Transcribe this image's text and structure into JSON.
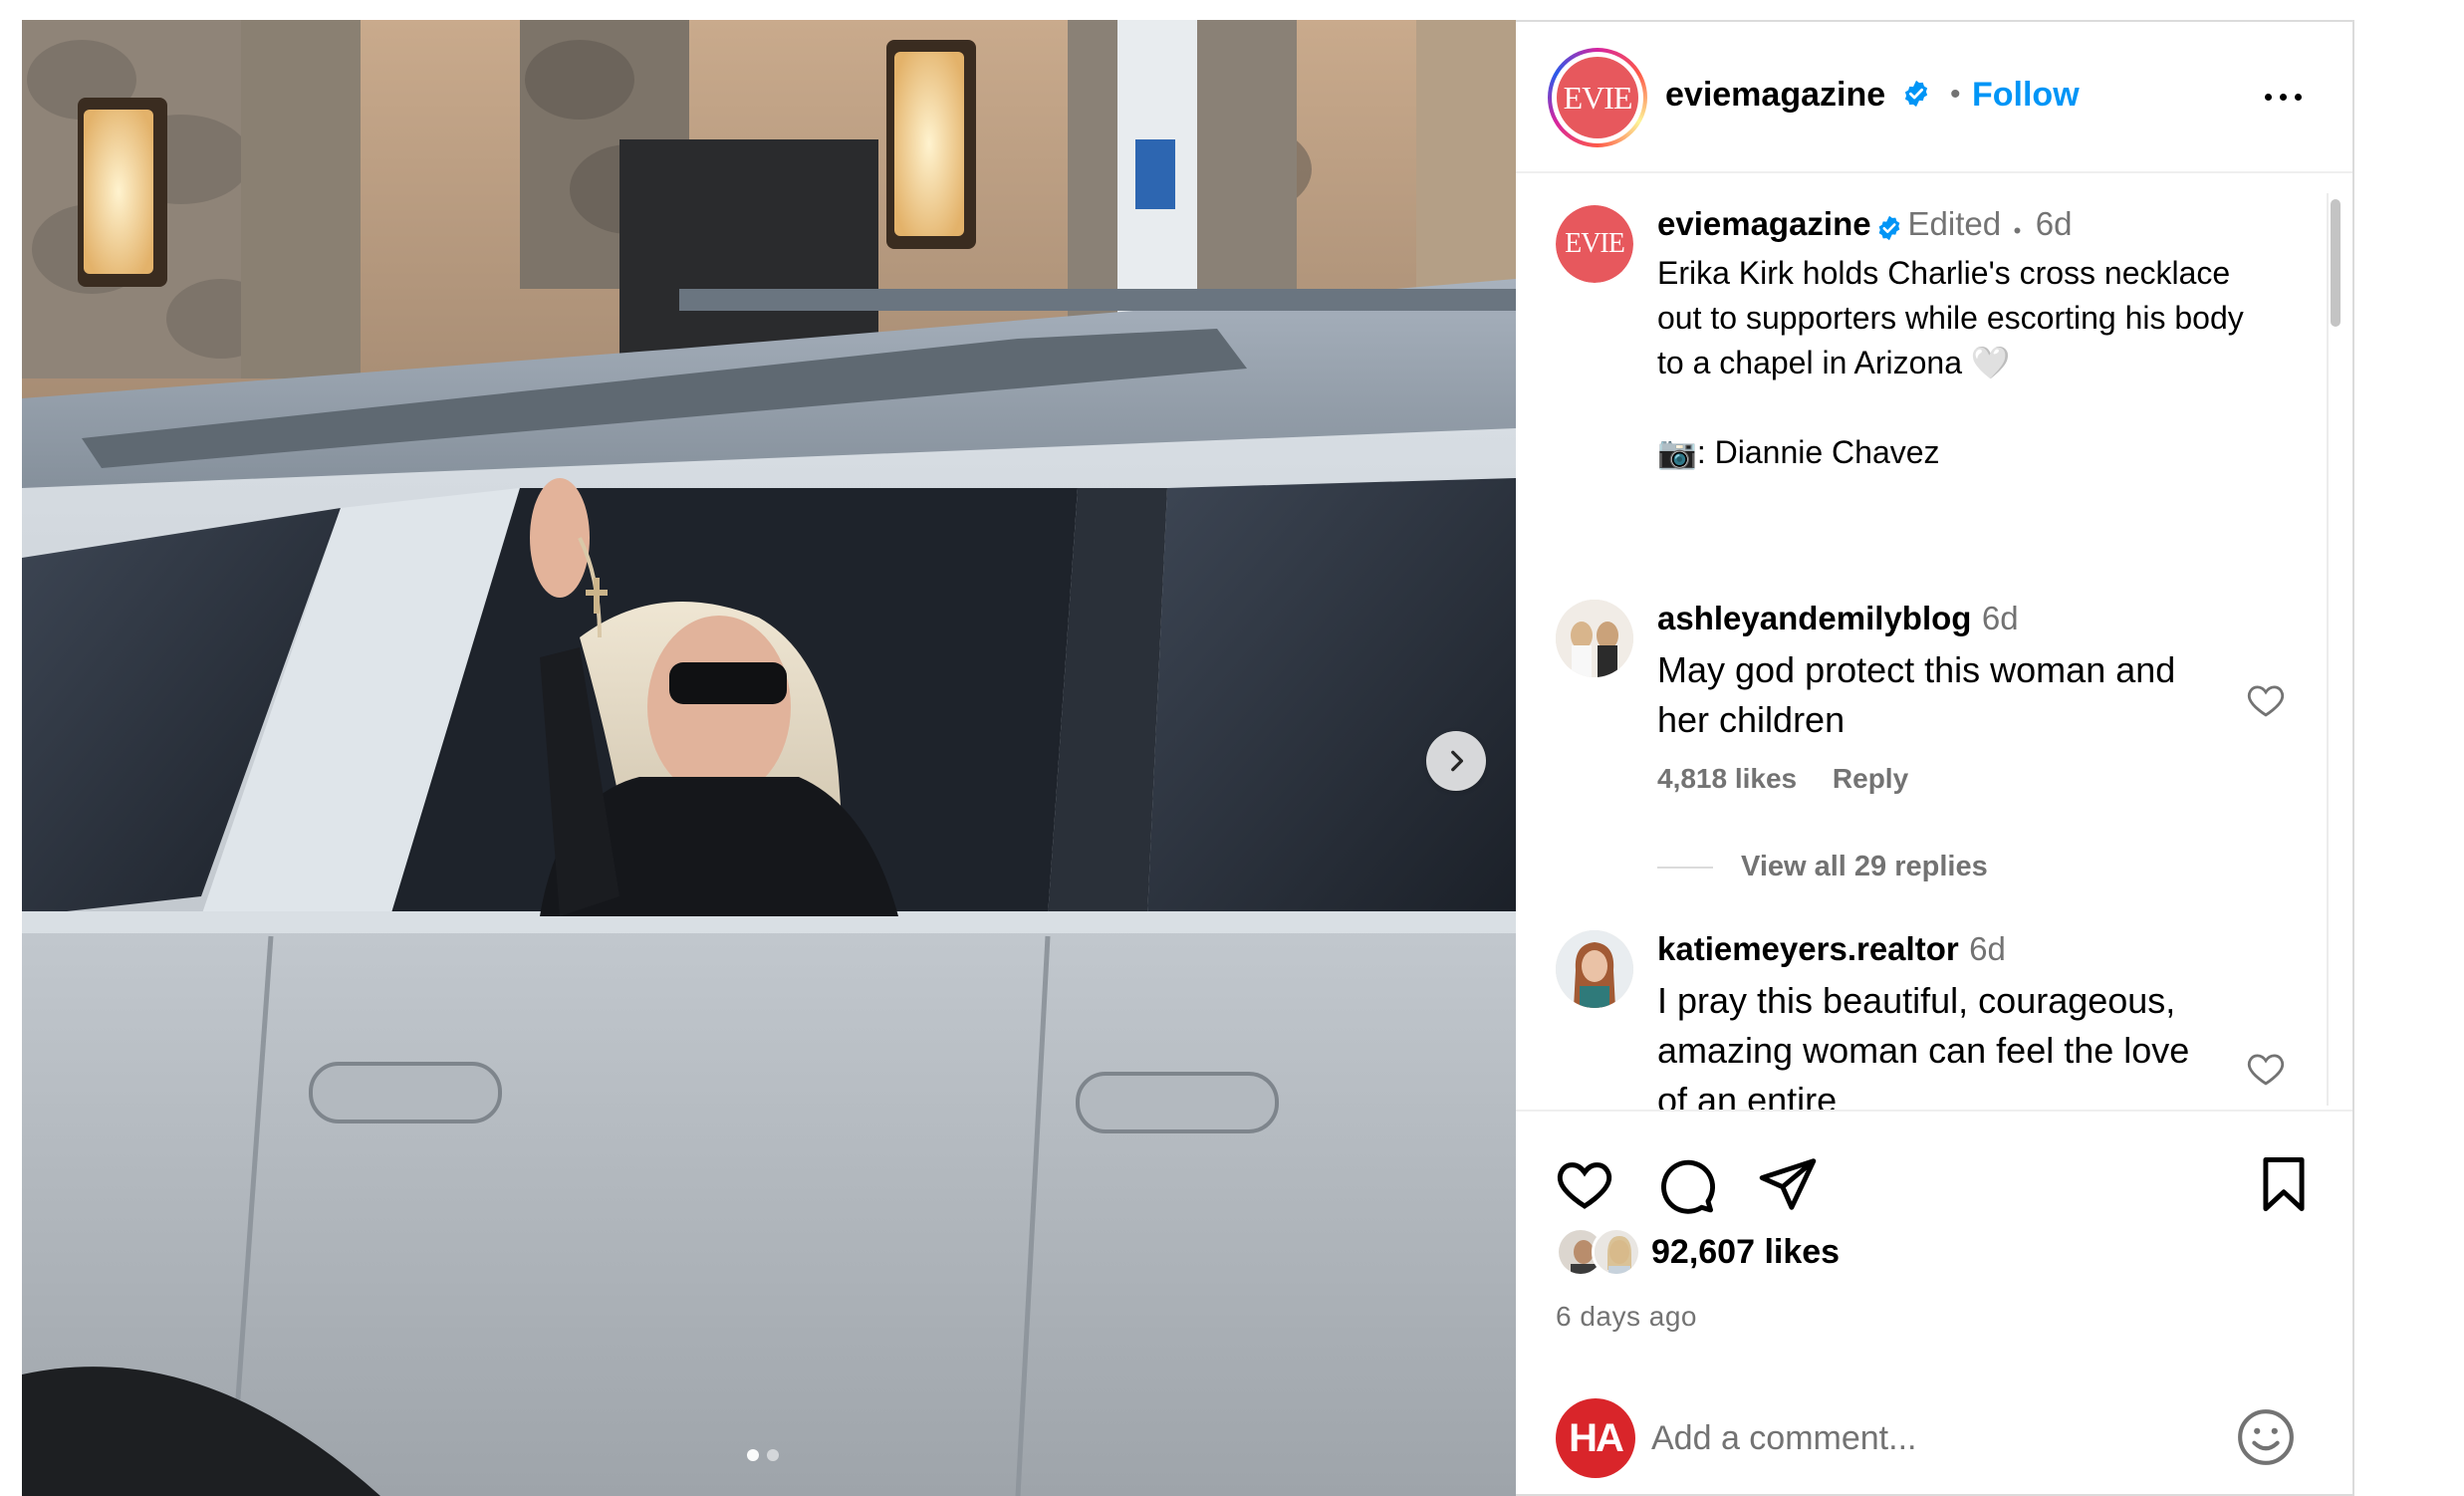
{
  "post": {
    "author": {
      "username": "eviemagazine",
      "avatar_text": "EVIE",
      "verified": true,
      "follow_label": "Follow",
      "separator": "•"
    },
    "carousel": {
      "total": 2,
      "current": 1
    },
    "caption": {
      "username": "eviemagazine",
      "edited_label": "Edited",
      "dot": "•",
      "age": "6d",
      "text": "Erika Kirk holds Charlie's cross necklace out to supporters while escorting his body to a chapel in Arizona 🤍",
      "credit": "📷: Diannie Chavez"
    },
    "comments": [
      {
        "username": "ashleyandemilyblog",
        "age": "6d",
        "text": "May god protect this woman and her children",
        "likes": "4,818 likes",
        "reply_label": "Reply",
        "view_replies": "View all 29 replies"
      },
      {
        "username": "katiemeyers.realtor",
        "age": "6d",
        "text": "I pray this beautiful, courageous, amazing woman can feel the love of an entire"
      }
    ],
    "likes_count": "92,607 likes",
    "time_ago": "6 days ago",
    "add_comment_placeholder": "Add a comment...",
    "viewer_avatar_text": "HA"
  },
  "colors": {
    "link_blue": "#0095f6",
    "muted": "#737373",
    "evie_red": "#e7585d",
    "viewer_red": "#d9252a"
  },
  "icons": [
    "verified-badge-icon",
    "more-options-icon",
    "chevron-right-icon",
    "heart-icon",
    "comment-icon",
    "share-icon",
    "bookmark-icon",
    "emoji-icon"
  ]
}
